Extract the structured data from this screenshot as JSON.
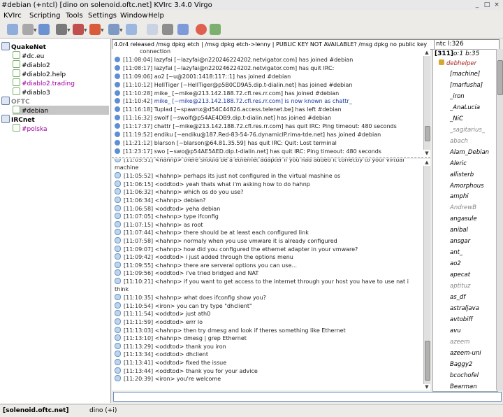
{
  "window": {
    "title": "#debian (+ntcl) [dino on solenoid.oftc.net] KVIrc 3.4.0 Virgo",
    "min_icon": "minimize-icon",
    "max_icon": "maximize-icon",
    "close_icon": "close-icon"
  },
  "menu": [
    "KVIrc",
    "Scripting",
    "Tools",
    "Settings",
    "Window",
    "Help"
  ],
  "tree": {
    "networks": [
      {
        "name": "QuakeNet",
        "channels": [
          "#dc.eu",
          "#diablo2",
          "#diablo2.help",
          "#diablo2.trading",
          "#diablo3"
        ]
      },
      {
        "name": "OFTC",
        "channels": [
          "#debian"
        ]
      },
      {
        "name": "IRCnet",
        "channels": [
          "#polska"
        ]
      }
    ],
    "selected": "#debian",
    "colors": {
      "highlight": "#a000a0",
      "activity": "#2e8b2e",
      "normal": "#000000"
    }
  },
  "topic": "4.0r4 released /msg dpkg etch | /msg dpkg etch->lenny | PUBLIC KEY NOT AVAILABLE? /msg dpkg no public key",
  "modes": "ntc l:326",
  "upper": {
    "lines": [
      {
        "ts": "",
        "text": "connection",
        "type": "cont"
      },
      {
        "ts": "[11:08:04]",
        "text": "lazyfai [~lazyfai@n220246224202.netvigator.com] has joined #debian",
        "type": "info"
      },
      {
        "ts": "[11:08:17]",
        "text": "lazyfai [~lazyfai@n220246224202.netvigator.com] has quit IRC:",
        "type": "info"
      },
      {
        "ts": "[11:09:06]",
        "text": "ao2 [~u@2001:1418:117::1] has joined #debian",
        "type": "info"
      },
      {
        "ts": "[11:10:12]",
        "text": "HellTiger [~HellTiger@p5B0CD9A5.dip.t-dialin.net] has joined #debian",
        "type": "info"
      },
      {
        "ts": "[11:10:28]",
        "text": "mike_ [~mike@213.142.188.72.cfl.res.rr.com] has joined #debian",
        "type": "info"
      },
      {
        "ts": "[11:10:42]",
        "text": "mike_ [~mike@213.142.188.72.cfl.res.rr.com] is now known as chattr_",
        "type": "nick"
      },
      {
        "ts": "[11:16:18]",
        "text": "Tuplad [~spawnx@d54C44826.access.telenet.be] has left #debian",
        "type": "info"
      },
      {
        "ts": "[11:16:32]",
        "text": "swolf [~swolf@p54AE4DB9.dip.t-dialin.net] has joined #debian",
        "type": "info"
      },
      {
        "ts": "[11:17:37]",
        "text": "chattr [~mike@213.142.188.72.cfl.res.rr.com] has quit IRC: Ping timeout: 480 seconds",
        "type": "info"
      },
      {
        "ts": "[11:19:52]",
        "text": "endiku [~endiku@187.Red-83-54-76.dynamicIP.rima-tde.net] has joined #debian",
        "type": "info"
      },
      {
        "ts": "[11:21:12]",
        "text": "blarson [~blarson@64.81.35.59] has quit IRC: Quit: Lost terminal",
        "type": "info"
      },
      {
        "ts": "[11:23:17]",
        "text": "swo [~swo@p54AE5AED.dip.t-dialin.net] has quit IRC: Ping timeout: 480 seconds",
        "type": "info"
      }
    ]
  },
  "lower": {
    "lines": [
      {
        "ts": "[11:05:51]",
        "text": "<hahnp> there should be a ethernet adapter if you had added it correctly to your virtual machine",
        "wrap": true
      },
      {
        "ts": "[11:05:52]",
        "text": "<hahnp> perhaps its just not configured in the virtual mashine os"
      },
      {
        "ts": "[11:06:15]",
        "text": "<oddtod> yeah thats what i'm asking how to do hahnp"
      },
      {
        "ts": "[11:06:32]",
        "text": "<hahnp> which os do you use?"
      },
      {
        "ts": "[11:06:34]",
        "text": "<hahnp> debian?"
      },
      {
        "ts": "[11:06:58]",
        "text": "<oddtod> yeha debian"
      },
      {
        "ts": "[11:07:05]",
        "text": "<hahnp> type ifconfig"
      },
      {
        "ts": "[11:07:15]",
        "text": "<hahnp> as root"
      },
      {
        "ts": "[11:07:44]",
        "text": "<hahnp> there should be at least each configured link"
      },
      {
        "ts": "[11:07:58]",
        "text": "<hahnp> normaly when you use vmware it is already configured"
      },
      {
        "ts": "[11:09:07]",
        "text": "<hahnp> how did you configured the ethernet adapter in your vmware?"
      },
      {
        "ts": "[11:09:42]",
        "text": "<oddtod> i just added through the options menu"
      },
      {
        "ts": "[11:09:55]",
        "text": "<hahnp> there are serveral options you can use..."
      },
      {
        "ts": "[11:09:56]",
        "text": "<oddtod> i've tried bridged and NAT"
      },
      {
        "ts": "[11:10:21]",
        "text": "<hahnp> if you want to get access to the internet through your host you have to use nat i think",
        "wrap": true
      },
      {
        "ts": "[11:10:35]",
        "text": "<hahnp> what does ifconfig show you?"
      },
      {
        "ts": "[11:10:54]",
        "text": "<iron> you can try type \"dhclient\""
      },
      {
        "ts": "[11:11:54]",
        "text": "<oddtod> just ath0"
      },
      {
        "ts": "[11:11:59]",
        "text": "<oddtod> errr lo"
      },
      {
        "ts": "[11:13:03]",
        "text": "<hahnp> then try dmesg and look if theres something like Ethernet"
      },
      {
        "ts": "[11:13:10]",
        "text": "<hahnp> dmesg | grep Ethernet"
      },
      {
        "ts": "[11:13:29]",
        "text": "<oddtod> thank  you iron"
      },
      {
        "ts": "[11:13:34]",
        "text": "<oddtod> dhclient"
      },
      {
        "ts": "[11:13:41]",
        "text": "<oddtod> fixed the issue"
      },
      {
        "ts": "[11:13:44]",
        "text": "<oddtod> thank you for your advice"
      },
      {
        "ts": "[11:20:39]",
        "text": "<iron> you're welcome"
      }
    ]
  },
  "userlist": {
    "header": "[311]",
    "header_modes": "o:1 b:35",
    "op": "debhelper",
    "users": [
      {
        "n": "[machine]"
      },
      {
        "n": "[marfusha]"
      },
      {
        "n": "_iron"
      },
      {
        "n": "_AnaLucia"
      },
      {
        "n": "_NiC"
      },
      {
        "n": "_sagitarius_",
        "away": true
      },
      {
        "n": "abach",
        "away": true
      },
      {
        "n": "Alam_Debian"
      },
      {
        "n": "Aleric"
      },
      {
        "n": "allisterb"
      },
      {
        "n": "Amorphous"
      },
      {
        "n": "amphi"
      },
      {
        "n": "AndrewB",
        "away": true
      },
      {
        "n": "angasule"
      },
      {
        "n": "anibal"
      },
      {
        "n": "ansgar"
      },
      {
        "n": "ant_"
      },
      {
        "n": "ao2"
      },
      {
        "n": "apecat"
      },
      {
        "n": "aptituz",
        "away": true
      },
      {
        "n": "as_df"
      },
      {
        "n": "astraljava"
      },
      {
        "n": "avtobiff"
      },
      {
        "n": "avu"
      },
      {
        "n": "azeem",
        "away": true
      },
      {
        "n": "azeem-uni"
      },
      {
        "n": "Baggy2"
      },
      {
        "n": "bcochofel"
      },
      {
        "n": "Bearman"
      },
      {
        "n": "benjamin"
      }
    ]
  },
  "status": {
    "server": "[solenoid.oftc.net]",
    "user": "dino (+i)"
  }
}
